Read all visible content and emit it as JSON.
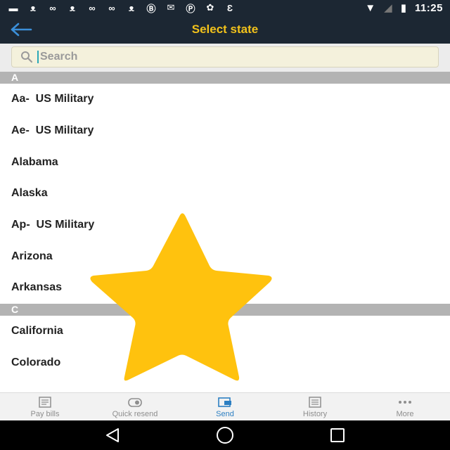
{
  "status_bar": {
    "time": "11:25",
    "icons": [
      "cat-icon",
      "infinity-icon",
      "cat-icon",
      "infinity-icon",
      "infinity-icon",
      "cat-icon",
      "bubble-icon",
      "mail-icon",
      "pinterest-icon",
      "apps-icon",
      "e-icon",
      "wifi-icon",
      "signal-icon",
      "battery-icon"
    ]
  },
  "app_bar": {
    "title": "Select state",
    "accent_color": "#f2c21b"
  },
  "search": {
    "placeholder": "Search"
  },
  "sections": [
    {
      "letter": "A",
      "items": [
        "Aa-  US Military",
        "Ae-  US Military",
        "Alabama",
        "Alaska",
        "Ap-  US Military",
        "Arizona",
        "Arkansas"
      ]
    },
    {
      "letter": "C",
      "items": [
        "California",
        "Colorado"
      ]
    }
  ],
  "tabs": [
    {
      "label": "Pay bills",
      "icon": "bills-icon"
    },
    {
      "label": "Quick resend",
      "icon": "resend-icon"
    },
    {
      "label": "Send",
      "icon": "send-icon",
      "active": true
    },
    {
      "label": "History",
      "icon": "history-icon"
    },
    {
      "label": "More",
      "icon": "more-icon"
    }
  ],
  "overlay": {
    "icon": "star-icon",
    "color": "#ffc20e"
  }
}
